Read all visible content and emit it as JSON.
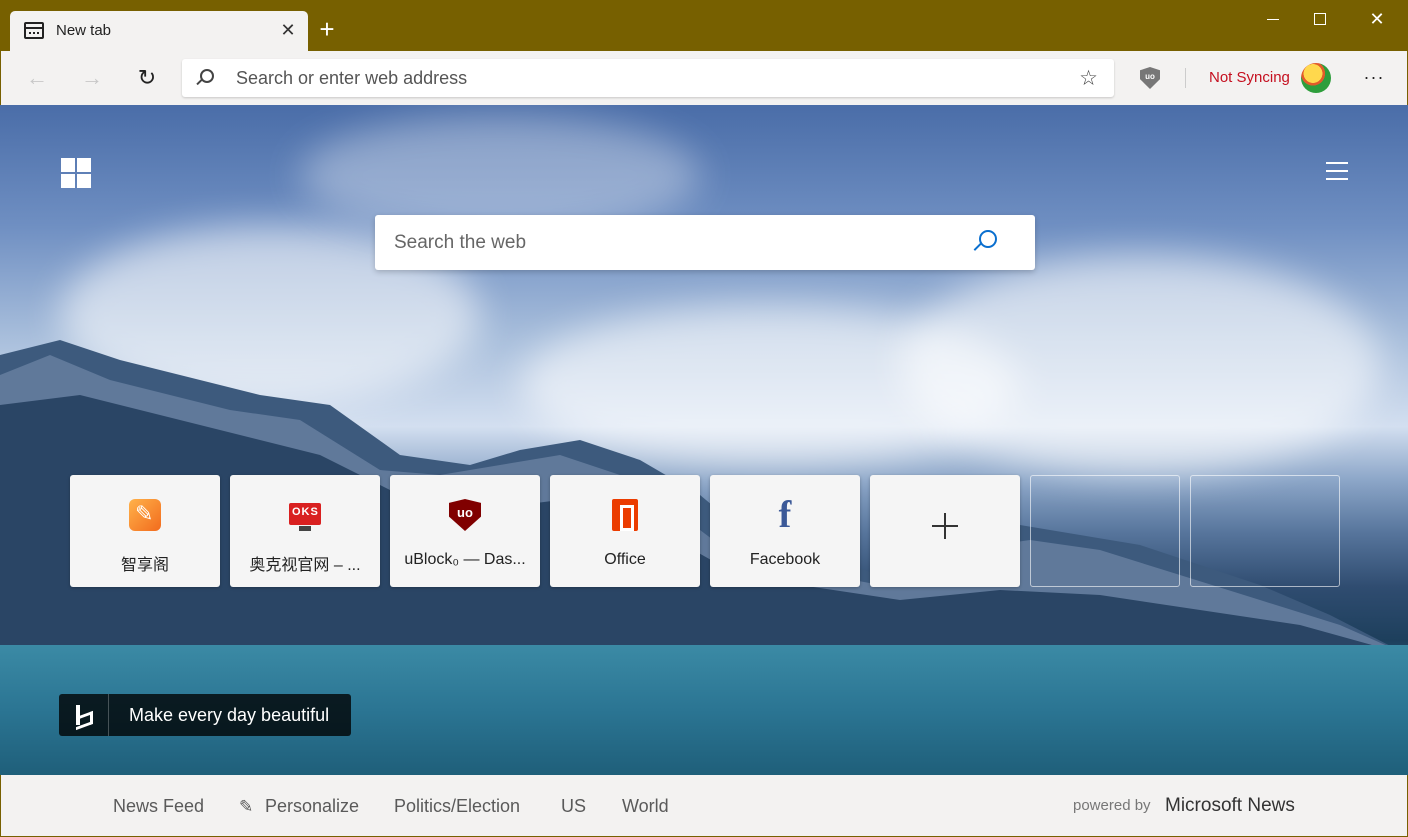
{
  "tab": {
    "title": "New tab",
    "close": "✕"
  },
  "new_tab": "+",
  "window": {
    "close": "✕"
  },
  "toolbar": {
    "back": "←",
    "forward": "→",
    "refresh": "↻",
    "address_placeholder": "Search or enter web address",
    "favorite": "☆",
    "extension": "uo",
    "sync_status": "Not Syncing",
    "more": "···"
  },
  "search": {
    "placeholder": "Search the web"
  },
  "tiles": [
    {
      "label": "智享阁",
      "icon": "zhixiang-icon"
    },
    {
      "label": "奥克视官网 – ...",
      "icon": "oks-icon"
    },
    {
      "label": "uBlock₀ — Das...",
      "icon": "ublock-icon"
    },
    {
      "label": "Office",
      "icon": "office-icon"
    },
    {
      "label": "Facebook",
      "icon": "facebook-icon",
      "glyph": "f"
    }
  ],
  "bing": {
    "text": "Make every day beautiful"
  },
  "news": {
    "items": [
      "News Feed",
      "Personalize",
      "Politics/Election",
      "US",
      "World"
    ],
    "powered_by": "powered by",
    "provider": "Microsoft News",
    "pencil": "✎"
  },
  "colors": {
    "titlebar": "#776000",
    "sync_red": "#c50f1f",
    "accent": "#0a6fcf"
  }
}
